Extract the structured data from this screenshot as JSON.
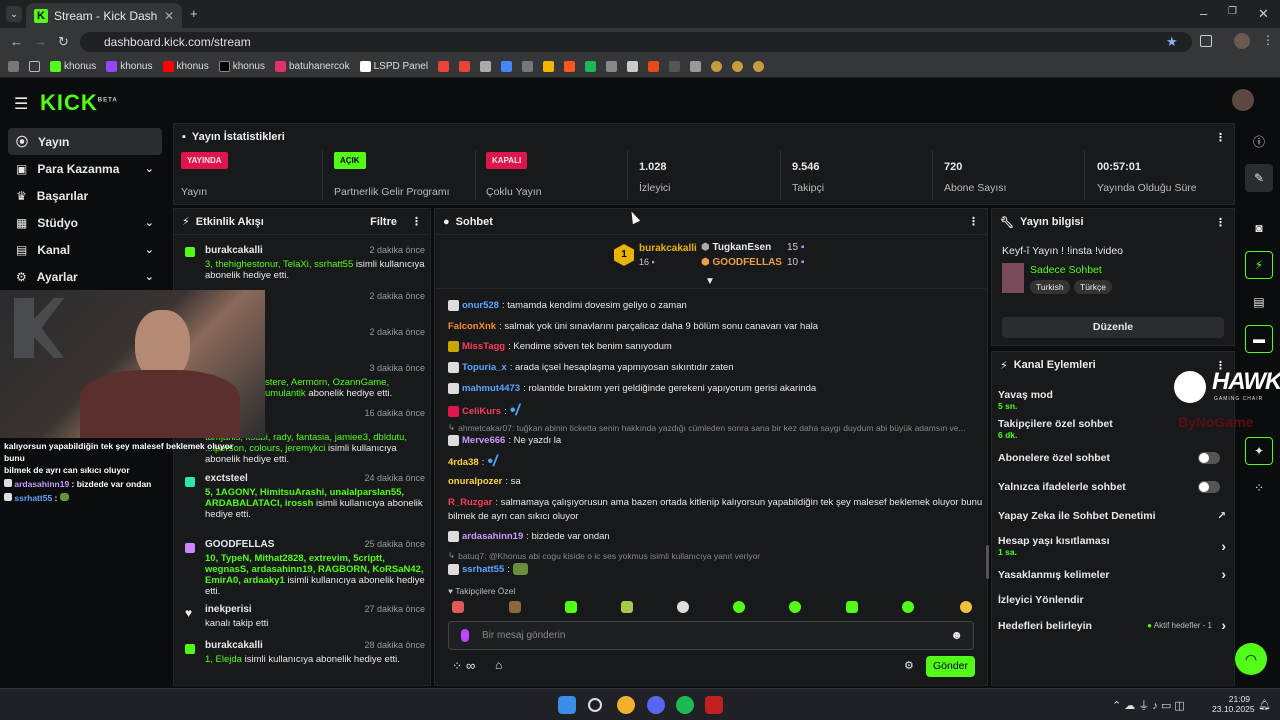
{
  "browser": {
    "tab_title": "Stream - Kick Dashboard",
    "url": "dashboard.kick.com/stream",
    "bookmarks": [
      "khonus",
      "khonus",
      "khonus",
      "khonus",
      "batuhanercok",
      "LSPD Panel"
    ]
  },
  "app": {
    "logo": "KICK",
    "logo_sup": "BETA"
  },
  "sidebar": {
    "items": [
      {
        "label": "Yayın",
        "icon": "broadcast-icon"
      },
      {
        "label": "Para Kazanma",
        "icon": "money-icon"
      },
      {
        "label": "Başarılar",
        "icon": "trophy-icon"
      },
      {
        "label": "Stüdyo",
        "icon": "studio-icon"
      },
      {
        "label": "Kanal",
        "icon": "channel-icon"
      },
      {
        "label": "Ayarlar",
        "icon": "settings-icon"
      }
    ]
  },
  "stats": {
    "title": "Yayın İstatistikleri",
    "cells": [
      {
        "badge": "YAYINDA",
        "badge_color": "#e0154c",
        "label": "Yayın"
      },
      {
        "badge": "AÇIK",
        "badge_color": "#53fc18",
        "label": "Partnerlik Gelir Programı"
      },
      {
        "badge": "KAPALI",
        "badge_color": "#e0154c",
        "label": "Çoklu Yayın"
      },
      {
        "value": "1.028",
        "label": "İzleyici"
      },
      {
        "value": "9.546",
        "label": "Takipçi"
      },
      {
        "value": "720",
        "label": "Abone Sayısı"
      },
      {
        "value": "00:57:01",
        "label": "Yayında Olduğu Süre"
      }
    ]
  },
  "feed": {
    "title": "Etkinlik Akışı",
    "filter": "Filtre",
    "items": [
      {
        "name": "burakcakalli",
        "time": "2 dakika önce",
        "names": "3, thehighestonur, TelaXi, ssrhatt55",
        "text": "isimli kullanıcıya abonelik hediye etti."
      },
      {
        "name": "",
        "time": "2 dakika önce",
        "names": "",
        "text": ""
      },
      {
        "name": "",
        "time": "2 dakika önce",
        "names": "",
        "text": ""
      },
      {
        "name": "",
        "time": "3 dakika önce",
        "names": "stere, Aermorn, OzannGame, umulantik",
        "text": "abonelik hediye etti."
      },
      {
        "name": "",
        "time": "16 dakika önce",
        "names": "tamjanis, ksubi, rady, fantasia, jamiee3, dbldutu, ...lperson, colours, jeremykci",
        "text": "isimli kullanıcıya abonelik hediye etti."
      },
      {
        "name": "exctsteel",
        "time": "24 dakika önce",
        "names": "5, 1AGONY, HimitsuArashi, unalalparslan55, ARDABALATACI, irossh",
        "text": "isimli kullanıcıya abonelik hediye etti."
      },
      {
        "name": "GOODFELLAS",
        "time": "25 dakika önce",
        "names": "10, TypeN, Mithat2828, extrevim, 5criptt, wegnasS, ardasahinn19, RAGBORN, KoRSaN42, EmirA0, ardaaky1",
        "text": "isimli kullanıcıya abonelik hediye etti."
      },
      {
        "name": "inekperisi",
        "time": "27 dakika önce",
        "names": "",
        "text": "kanalı takip etti"
      },
      {
        "name": "burakcakalli",
        "time": "28 dakika önce",
        "names": "1, Elejda",
        "text": "isimli kullanıcıya abonelik hediye etti."
      }
    ]
  },
  "chat": {
    "title": "Sohbet",
    "leaders": [
      {
        "rank": "1",
        "name": "burakcakalli",
        "count": "16"
      },
      {
        "name": "TugkanEsen",
        "count": "15"
      },
      {
        "name": "GOODFELLAS",
        "count": "10"
      }
    ],
    "messages": [
      {
        "user": "onur528",
        "color": "#5aa7ff",
        "text": ": tamamda kendimi dovesim geliyo o zaman"
      },
      {
        "user": "FalconXnk",
        "color": "#ff8c2a",
        "text": ": salmak yok üni sınavlarını parçalicaz daha 9 bölüm sonu canavarı var hala"
      },
      {
        "user": "MissTagg",
        "color": "#ff3b5c",
        "text": ": Kendime söven tek benim sanıyodum"
      },
      {
        "user": "Topuria_x",
        "color": "#5aa7ff",
        "text": ": arada içsel hesaplaşma yapmıyosan sıkıntıdır zaten"
      },
      {
        "user": "mahmut4473",
        "color": "#5aa7ff",
        "text": ": rolantide bıraktım yeri geldiğinde gerekeni yapıyorum gerisi akarinda"
      },
      {
        "user": "CeliKurs",
        "color": "#ff3b5c",
        "text": ":"
      },
      {
        "reply": "ahmetcakar07: tuğkan abinin ticketta senin hakkında yazdığı cümleden sonra sana bir kez daha saygı duydum abi büyük adamsın ve..."
      },
      {
        "user": "Merve666",
        "color": "#c79bff",
        "text": ": Ne yazdı la"
      },
      {
        "user": "4rda38",
        "color": "#ffd43b",
        "text": ":"
      },
      {
        "user": "onuralpozer",
        "color": "#ffd43b",
        "text": ": sa"
      },
      {
        "user": "R_Ruzgar",
        "color": "#ff3b5c",
        "text": ": salmamaya çalışıyorusun ama bazen ortada kitlenip kalıyorsun yapabildiğin tek şey malesef beklemek oluyor bunu"
      },
      {
        "cont": "bilmek de ayrı can sıkıcı oluyor"
      },
      {
        "user": "ardasahinn19",
        "color": "#c79bff",
        "text": ": bizdede var ondan"
      },
      {
        "reply": "batuq7: @Khonus abi cogu kiside o ic ses yokmus isimli kullanıcıya yanıt veriyor"
      },
      {
        "user": "ssrhatt55",
        "color": "#5aa7ff",
        "text": ":"
      }
    ],
    "followers_only": "Takipçilere Özel",
    "input_placeholder": "Bir mesaj gönderin",
    "send": "Gönder"
  },
  "overlay_chat": [
    {
      "text": "kalıyorsun yapabildiğin tek şey malesef beklemek oluyor bunu"
    },
    {
      "text": "bilmek de ayrı can sıkıcı oluyor"
    },
    {
      "user": "ardasahinn19",
      "text": " : bizdede var ondan"
    },
    {
      "user": "ssrhatt55",
      "text": " : "
    }
  ],
  "stream_info": {
    "title": "Yayın bilgisi",
    "stream_title": "Keyf-î Yayın ! !insta !video",
    "category": "Sadece Sohbet",
    "tags": [
      "Turkish",
      "Türkçe"
    ],
    "edit": "Düzenle"
  },
  "channel_actions": {
    "title": "Kanal Eylemleri",
    "items": [
      {
        "label": "Yavaş mod",
        "sub": "5 sn."
      },
      {
        "label": "Takipçilere özel sohbet",
        "sub": "6 dk."
      },
      {
        "label": "Abonelere özel sohbet",
        "toggle": true
      },
      {
        "label": "Yalnızca ifadelerle sohbet",
        "toggle": true
      },
      {
        "label": "Yapay Zeka ile Sohbet Denetimi",
        "ext": true
      },
      {
        "label": "Hesap yaşı kısıtlaması",
        "sub": "1 sa.",
        "arrow": true
      },
      {
        "label": "Yasaklanmış kelimeler",
        "arrow": true
      },
      {
        "label": "İzleyici Yönlendir"
      },
      {
        "label": "Hedefleri belirleyin",
        "right": "Aktif hedefler - 1",
        "arrow": true
      }
    ]
  },
  "overlay_brand": {
    "name": "HAWK",
    "sub": "GAMING CHAIR",
    "sub2": "ByNoGame"
  },
  "taskbar": {
    "time": "21:09",
    "date": "23.10.2025"
  }
}
